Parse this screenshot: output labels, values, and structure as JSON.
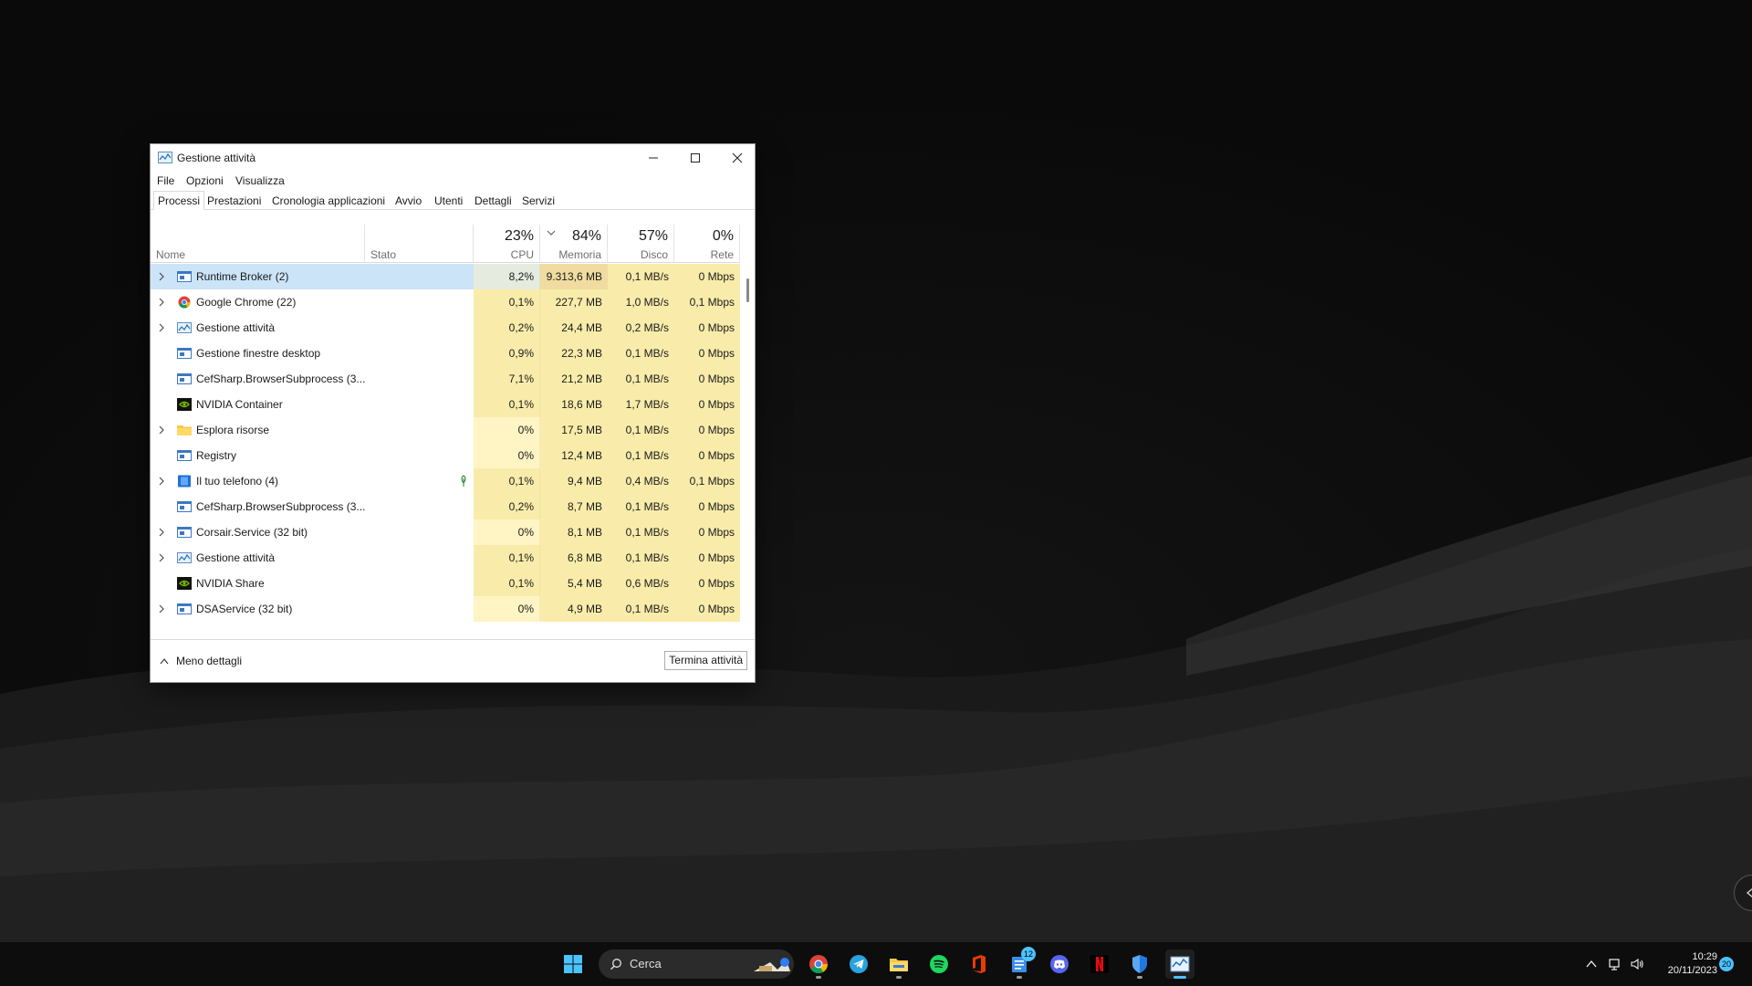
{
  "window": {
    "title": "Gestione attività",
    "menu": [
      "File",
      "Opzioni",
      "Visualizza"
    ],
    "tabs": [
      "Processi",
      "Prestazioni",
      "Cronologia applicazioni",
      "Avvio",
      "Utenti",
      "Dettagli",
      "Servizi"
    ],
    "active_tab": "Processi"
  },
  "columns": {
    "name": "Nome",
    "state": "Stato",
    "cpu": {
      "pct": "23%",
      "label": "CPU"
    },
    "memory": {
      "pct": "84%",
      "label": "Memoria"
    },
    "disk": {
      "pct": "57%",
      "label": "Disco"
    },
    "network": {
      "pct": "0%",
      "label": "Rete"
    }
  },
  "processes": [
    {
      "name": "Runtime Broker (2)",
      "icon": "service-window-icon",
      "expandable": true,
      "cpu": "8,2%",
      "mem": "9.313,6 MB",
      "disk": "0,1 MB/s",
      "net": "0 Mbps",
      "selected": true
    },
    {
      "name": "Google Chrome (22)",
      "icon": "chrome-icon",
      "expandable": true,
      "cpu": "0,1%",
      "mem": "227,7 MB",
      "disk": "1,0 MB/s",
      "net": "0,1 Mbps"
    },
    {
      "name": "Gestione attività",
      "icon": "task-manager-icon",
      "expandable": true,
      "cpu": "0,2%",
      "mem": "24,4 MB",
      "disk": "0,2 MB/s",
      "net": "0 Mbps"
    },
    {
      "name": "Gestione finestre desktop",
      "icon": "service-window-icon",
      "expandable": false,
      "cpu": "0,9%",
      "mem": "22,3 MB",
      "disk": "0,1 MB/s",
      "net": "0 Mbps"
    },
    {
      "name": "CefSharp.BrowserSubprocess (3...",
      "icon": "service-window-icon",
      "expandable": false,
      "cpu": "7,1%",
      "mem": "21,2 MB",
      "disk": "0,1 MB/s",
      "net": "0 Mbps"
    },
    {
      "name": "NVIDIA Container",
      "icon": "nvidia-icon",
      "expandable": false,
      "cpu": "0,1%",
      "mem": "18,6 MB",
      "disk": "1,7 MB/s",
      "net": "0 Mbps"
    },
    {
      "name": "Esplora risorse",
      "icon": "folder-icon",
      "expandable": true,
      "cpu": "0%",
      "mem": "17,5 MB",
      "disk": "0,1 MB/s",
      "net": "0 Mbps"
    },
    {
      "name": "Registry",
      "icon": "service-window-icon",
      "expandable": false,
      "cpu": "0%",
      "mem": "12,4 MB",
      "disk": "0,1 MB/s",
      "net": "0 Mbps"
    },
    {
      "name": "Il tuo telefono (4)",
      "icon": "phone-link-icon",
      "expandable": true,
      "cpu": "0,1%",
      "mem": "9,4 MB",
      "disk": "0,4 MB/s",
      "net": "0,1 Mbps",
      "suspended_leaf": true
    },
    {
      "name": "CefSharp.BrowserSubprocess (3...",
      "icon": "service-window-icon",
      "expandable": false,
      "cpu": "0,2%",
      "mem": "8,7 MB",
      "disk": "0,1 MB/s",
      "net": "0 Mbps"
    },
    {
      "name": "Corsair.Service (32 bit)",
      "icon": "service-window-icon",
      "expandable": true,
      "cpu": "0%",
      "mem": "8,1 MB",
      "disk": "0,1 MB/s",
      "net": "0 Mbps"
    },
    {
      "name": "Gestione attività",
      "icon": "task-manager-icon",
      "expandable": true,
      "cpu": "0,1%",
      "mem": "6,8 MB",
      "disk": "0,1 MB/s",
      "net": "0 Mbps"
    },
    {
      "name": "NVIDIA Share",
      "icon": "nvidia-icon",
      "expandable": false,
      "cpu": "0,1%",
      "mem": "5,4 MB",
      "disk": "0,6 MB/s",
      "net": "0 Mbps"
    },
    {
      "name": "DSAService (32 bit)",
      "icon": "service-window-icon",
      "expandable": true,
      "cpu": "0%",
      "mem": "4,9 MB",
      "disk": "0,1 MB/s",
      "net": "0 Mbps"
    }
  ],
  "footer": {
    "less_details": "Meno dettagli",
    "end_task": "Termina attività"
  },
  "taskbar": {
    "search_placeholder": "Cerca",
    "apps": [
      "start-icon",
      "chrome-icon",
      "telegram-icon",
      "file-explorer-icon",
      "spotify-icon",
      "office-icon",
      "notes-icon",
      "discord-icon",
      "netflix-icon",
      "defender-icon",
      "task-manager-icon"
    ],
    "notes_badge": "12",
    "time": "10:29",
    "date": "20/11/2023",
    "notification_count": "20"
  },
  "colors": {
    "heat_high": "#f9ecaa",
    "heat_mid": "#fbf0b9",
    "heat_low": "#fff4c4",
    "mem_selected": "#f0dca0",
    "selection": "#cce4f7",
    "accent": "#4cc2ff"
  }
}
